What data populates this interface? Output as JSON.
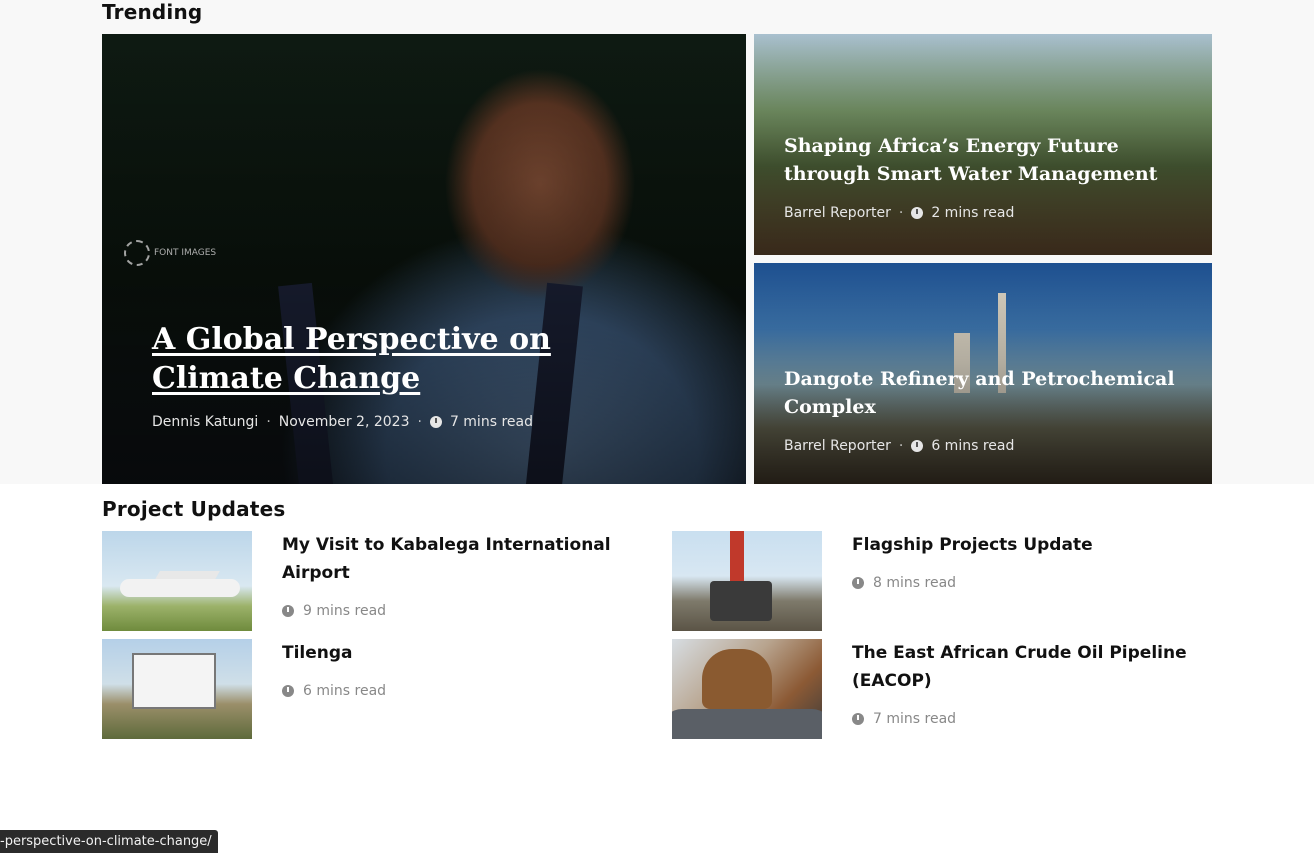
{
  "trending": {
    "heading": "Trending",
    "featured": {
      "title": "A Global Perspective on Climate Change",
      "author": "Dennis Katungi",
      "date": "November 2, 2023",
      "read_time": "7 mins read",
      "watermark": "FONT IMAGES"
    },
    "side": [
      {
        "title": "Shaping Africa’s Energy Future through Smart Water Management",
        "author": "Barrel Reporter",
        "read_time": "2 mins read"
      },
      {
        "title": "Dangote Refinery and Petrochemical Complex",
        "author": "Barrel Reporter",
        "read_time": "6 mins read"
      }
    ]
  },
  "project_updates": {
    "heading": "Project Updates",
    "items": [
      {
        "title": "My Visit to Kabalega International Airport",
        "read_time": "9 mins read",
        "thumb": "airplane-photo"
      },
      {
        "title": "Flagship Projects Update",
        "read_time": "8 mins read",
        "thumb": "drilling-truck-photo"
      },
      {
        "title": "Tilenga",
        "read_time": "6 mins read",
        "thumb": "project-signboard-photo"
      },
      {
        "title": "The East African Crude Oil Pipeline (EACOP)",
        "read_time": "7 mins read",
        "thumb": "pipeline-welder-photo"
      }
    ]
  },
  "status_bar": {
    "url": "-perspective-on-climate-change/"
  },
  "icons": {
    "read_time": "clock-icon"
  }
}
